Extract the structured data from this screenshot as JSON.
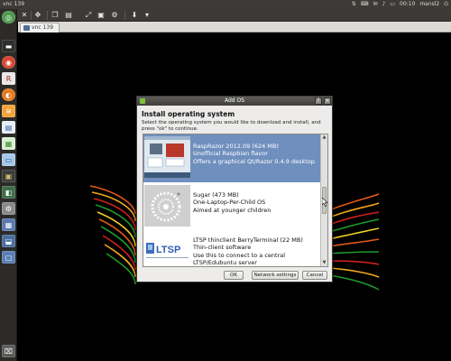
{
  "top_panel": {
    "title": "vnc 139",
    "clock": "00:10",
    "user": "mansl2",
    "tray_icons": [
      "network-icon",
      "keyboard-icon",
      "mail-icon",
      "volume-icon",
      "battery-icon",
      "power-icon"
    ]
  },
  "vnc": {
    "tab_label": "vnc 139",
    "toolbar_icons": [
      "close-icon",
      "move-icon",
      "copy-icon",
      "paste-icon",
      "fullscreen-icon",
      "screenshot-icon",
      "settings-icon",
      "download-icon",
      "view-icon"
    ]
  },
  "launcher": {
    "icons": [
      "dash-icon",
      "terminal-icon",
      "chrome-icon",
      "r-icon",
      "firefox-icon",
      "feed-icon",
      "document-icon",
      "spreadsheet-icon",
      "monitor-icon",
      "image-icon",
      "settings-icon",
      "shell-icon",
      "network-icon",
      "window-icon",
      "trash-icon"
    ]
  },
  "dialog": {
    "title": "Add OS",
    "help_button": "?",
    "close_button": "×",
    "heading": "Install operating system",
    "instructions": "Select the operating system you would like to download and install, and press \"ok\" to continue.",
    "os_items": [
      {
        "line1": "RaspRazor 2012.09 (624 MB)",
        "line2": "Unofficial Raspbian flavor",
        "line3": "Offers a graphical Qt/Razor 0.4.9 desktop.",
        "line4": "",
        "selected": true
      },
      {
        "line1": "Sugar (473 MB)",
        "line2": "One-Laptop-Per-Child OS",
        "line3": "Aimed at younger children",
        "line4": "",
        "selected": false
      },
      {
        "line1": "LTSP thinclient BerryTerminal (22 MB)",
        "line2": "Thin-client software",
        "line3": "Use this to connect to a central",
        "line4": "LTSP/Edubuntu server",
        "selected": false
      }
    ],
    "ltsp_logo_text": "LTSP",
    "buttons": {
      "ok": "OK",
      "network_settings": "Network settings",
      "cancel": "Cancel"
    }
  },
  "colors": {
    "selection": "#6f8fbe",
    "desktop_background": "#000000",
    "panel": "#3c3b37"
  }
}
